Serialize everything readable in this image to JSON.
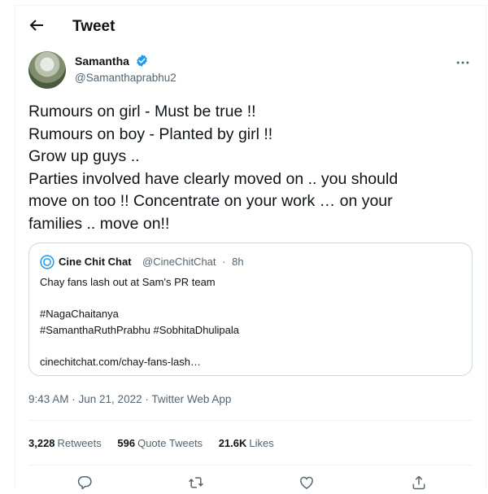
{
  "header": {
    "title": "Tweet",
    "back_icon": "arrow-left-icon"
  },
  "author": {
    "name": "Samantha",
    "handle": "@Samanthaprabhu2",
    "verified_color": "#1d9bf0"
  },
  "tweet": {
    "lines": [
      "Rumours on girl - Must be true !!",
      "Rumours on boy - Planted by girl !!",
      "Grow up guys ..",
      "Parties involved have clearly moved on .. you should",
      "move on too !! Concentrate on your work … on your",
      "families .. move on!!"
    ]
  },
  "quote": {
    "name": "Cine Chit Chat",
    "handle": "@CineChitChat",
    "separator": "·",
    "time": "8h",
    "lines": [
      "Chay fans lash out at Sam's PR team",
      "",
      "#NagaChaitanya",
      "#SamanthaRuthPrabhu #SobhitaDhulipala",
      "",
      "cinechitchat.com/chay-fans-lash…"
    ]
  },
  "meta": {
    "timestamp": "9:43 AM · Jun 21, 2022 · Twitter Web App"
  },
  "stats": {
    "retweets": {
      "count": "3,228",
      "label": "Retweets"
    },
    "quotes": {
      "count": "596",
      "label": "Quote Tweets"
    },
    "likes": {
      "count": "21.6K",
      "label": "Likes"
    }
  },
  "actions": [
    "reply-icon",
    "retweet-icon",
    "like-icon",
    "share-icon"
  ],
  "colors": {
    "text": "#0f1419",
    "secondary": "#536471",
    "border": "#cfd9de",
    "accent": "#1d9bf0"
  }
}
